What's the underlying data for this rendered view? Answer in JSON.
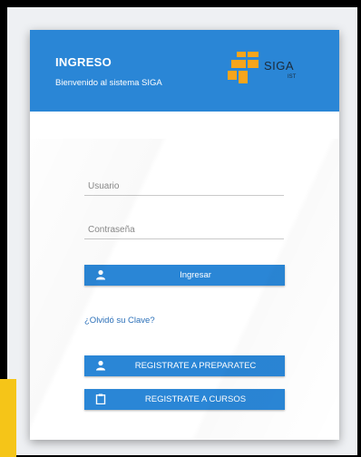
{
  "header": {
    "title": "INGRESO",
    "subtitle": "Bienvenido al sistema SIGA"
  },
  "logo": {
    "text": "SIGA",
    "subtext": "IST"
  },
  "form": {
    "username_placeholder": "Usuario",
    "password_placeholder": "Contraseña",
    "login_label": "Ingresar",
    "forgot_label": "¿Olvidó su Clave?",
    "register_preparatec_label": "REGISTRATE A PREPARATEC",
    "register_cursos_label": "REGISTRATE A CURSOS"
  },
  "colors": {
    "accent": "#2a86d6",
    "logo_orange": "#f7a51c",
    "side_yellow": "#f5c518"
  }
}
